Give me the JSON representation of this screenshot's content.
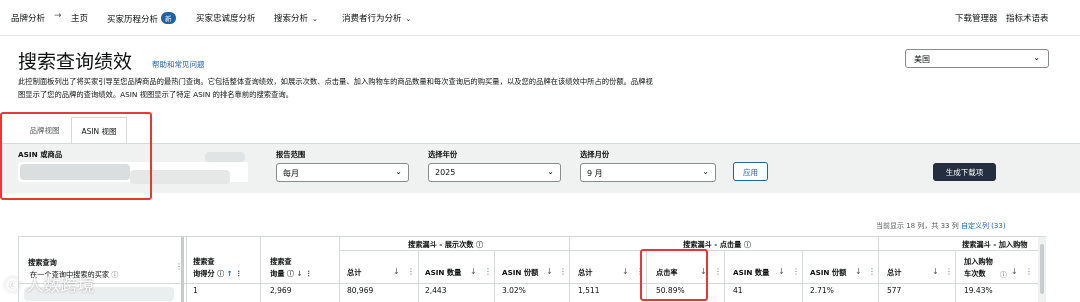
{
  "nav": {
    "brand_analytics": "品牌分析",
    "home": "主页",
    "buyer_journey": "买家历程分析",
    "new_badge": "新",
    "buyer_loyalty": "买家忠诚度分析",
    "search_analysis": "搜索分析",
    "consumer_behavior": "消费者行为分析",
    "download_manager": "下载管理器",
    "glossary": "指标术语表"
  },
  "header": {
    "title": "搜索查询绩效",
    "help_link": "帮助和常见问题",
    "description": "此控制面板列出了将买家引导至您品牌商品的最热门查询。它包括整体查询绩效，如展示次数、点击量、加入购物车的商品数量和每次查询后的购买量，以及您的品牌在该绩效中所占的份额。品牌视图显示了您的品牌的查询绩效。ASIN 视图显示了特定 ASIN 的排名靠前的搜索查询。",
    "country": "美国"
  },
  "tabs": [
    {
      "label": "品牌视图"
    },
    {
      "label": "ASIN 视图"
    }
  ],
  "filters": {
    "asin_label": "ASIN 或商品",
    "report_range_label": "报告范围",
    "report_range_value": "每月",
    "year_label": "选择年份",
    "year_value": "2025",
    "month_label": "选择月份",
    "month_value": "9 月",
    "apply_button": "应用",
    "generate_download": "生成下载项"
  },
  "table": {
    "count_text": "当前显示 18 列，共 33 列",
    "customize_columns": "自定义列 (33)",
    "groups": {
      "impressions": "搜索漏斗 - 展示次数",
      "clicks": "搜索漏斗 - 点击量",
      "cart": "搜索漏斗 - 加入购物"
    },
    "columns": {
      "search_query": "搜索查询",
      "search_query_sub": "在一个查询中搜索的买家",
      "score_line1": "搜索查",
      "score_line2": "询得分",
      "volume_line1": "搜索查",
      "volume_line2": "询量",
      "imp_total": "总计",
      "imp_asin_count": "ASIN 数量",
      "imp_asin_share": "ASIN 份额",
      "clk_total": "总计",
      "clk_rate": "点击率",
      "clk_asin_count": "ASIN 数量",
      "clk_asin_share": "ASIN 份额",
      "cart_total": "总计",
      "cart_count_line1": "加入购物",
      "cart_count_line2": "车次数"
    },
    "rows": [
      {
        "score": "1",
        "volume": "2,969",
        "imp_total": "80,969",
        "imp_asin_count": "2,443",
        "imp_asin_share": "3.02%",
        "clk_total": "1,511",
        "clk_rate": "50.89%",
        "clk_asin_count": "41",
        "clk_asin_share": "2.71%",
        "cart_total": "577",
        "cart_count": "19.43%"
      }
    ]
  },
  "watermark": "人数跨境"
}
